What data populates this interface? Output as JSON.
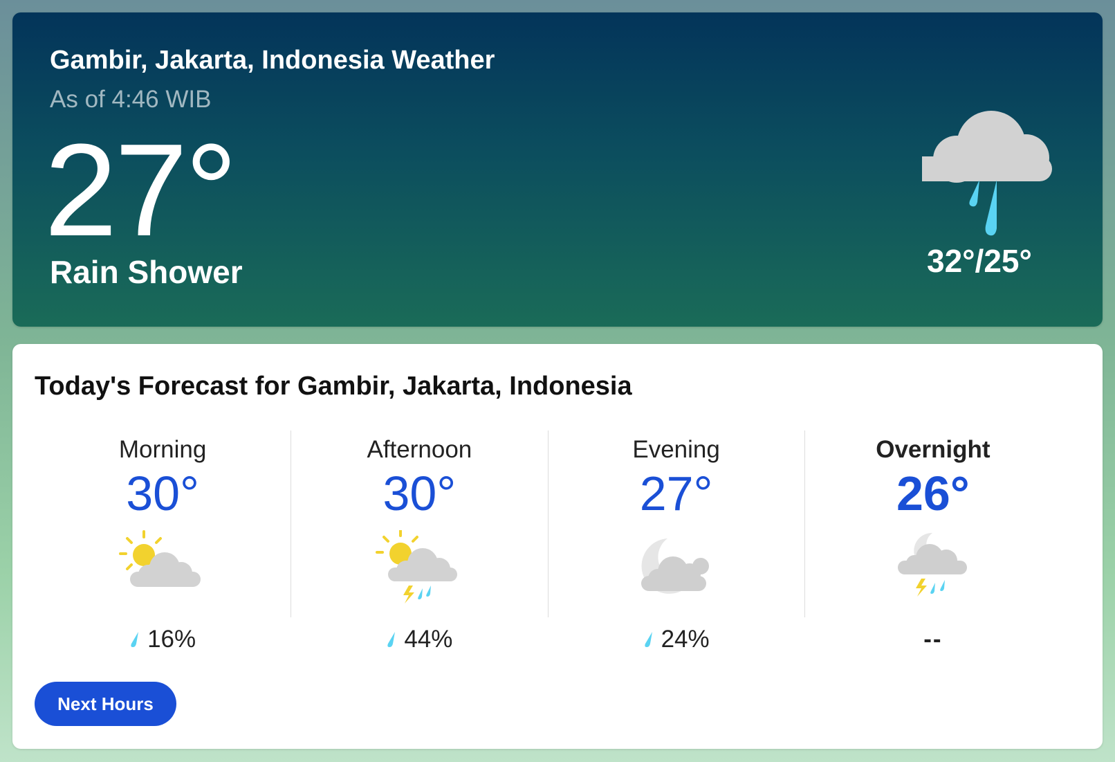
{
  "current": {
    "title": "Gambir, Jakarta, Indonesia Weather",
    "as_of": "As of 4:46 WIB",
    "temperature": "27°",
    "phrase": "Rain Shower",
    "icon": "rain-shower-icon",
    "hi_lo": "32°/25°"
  },
  "forecast": {
    "title": "Today's Forecast for Gambir, Jakarta, Indonesia",
    "periods": [
      {
        "label": "Morning",
        "temp": "30°",
        "icon": "partly-cloudy-icon",
        "precip": "16%"
      },
      {
        "label": "Afternoon",
        "temp": "30°",
        "icon": "thunderstorm-icon",
        "precip": "44%"
      },
      {
        "label": "Evening",
        "temp": "27°",
        "icon": "mostly-cloudy-night-icon",
        "precip": "24%"
      },
      {
        "label": "Overnight",
        "temp": "26°",
        "icon": "night-thunderstorm-icon",
        "precip": "--"
      }
    ],
    "next_button": "Next Hours"
  },
  "colors": {
    "accent": "#1a4fd6",
    "hero_top": "#03345a",
    "hero_bottom": "#1a6b58",
    "rain_drop": "#5ad3f2",
    "lightning": "#f2d22e",
    "cloud": "#d2d2d2",
    "sun": "#f2d22e"
  }
}
